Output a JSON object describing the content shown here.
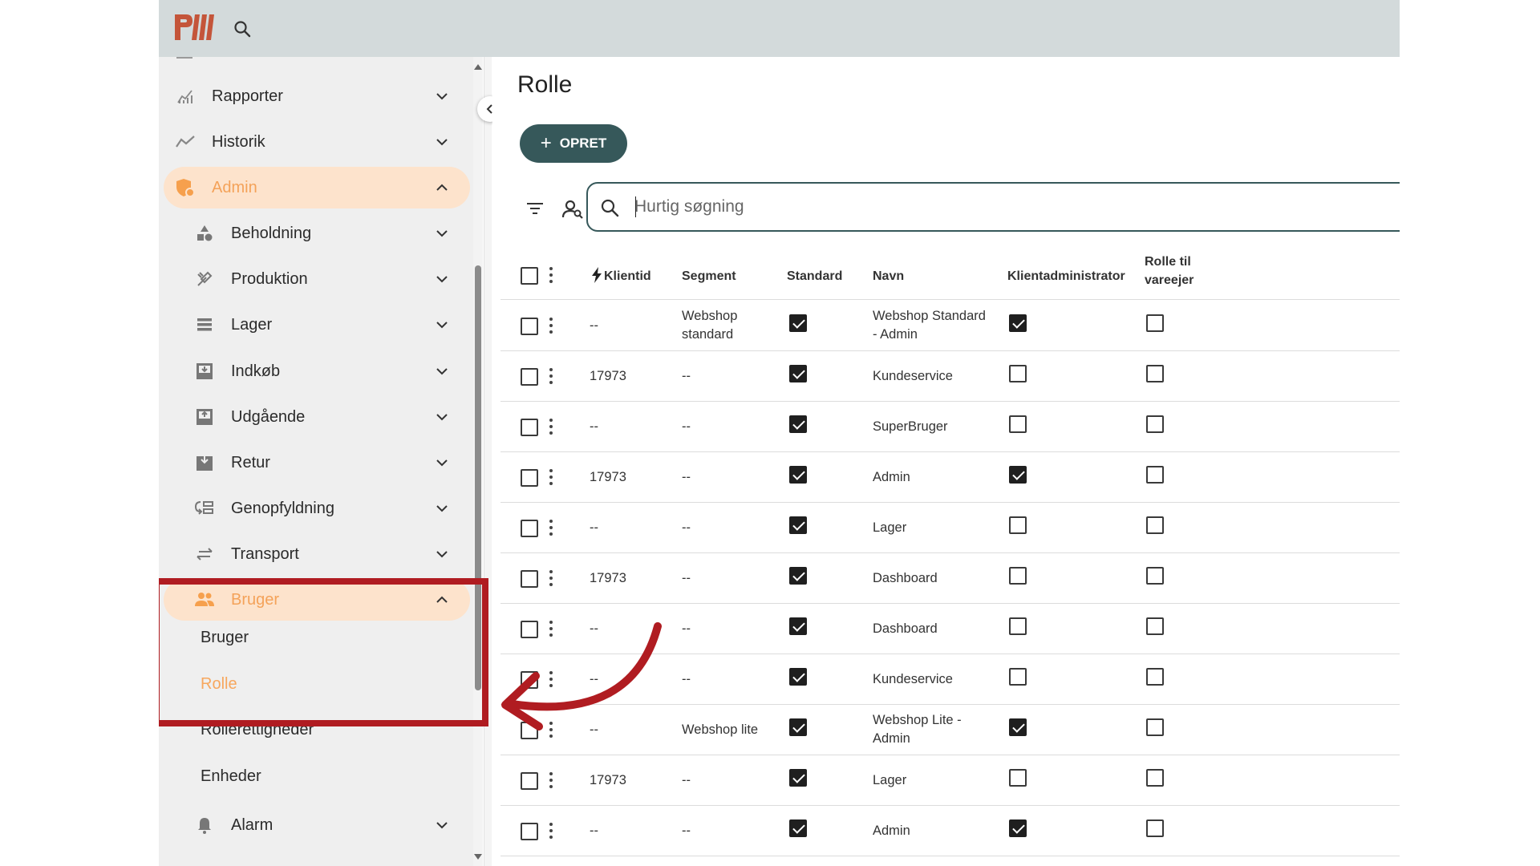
{
  "app": {
    "logo_text": "PW"
  },
  "sidebar": {
    "items": [
      {
        "label": "Rapporter",
        "icon": "reports-chart-icon"
      },
      {
        "label": "Historik",
        "icon": "trend-line-icon"
      },
      {
        "label": "Admin",
        "icon": "admin-shield-icon",
        "active": true,
        "expanded": true
      },
      {
        "label": "Beholdning",
        "icon": "shapes-icon"
      },
      {
        "label": "Produktion",
        "icon": "tools-icon"
      },
      {
        "label": "Lager",
        "icon": "list-icon"
      },
      {
        "label": "Indkøb",
        "icon": "inbox-in-icon"
      },
      {
        "label": "Udgående",
        "icon": "outbox-icon"
      },
      {
        "label": "Retur",
        "icon": "return-box-icon"
      },
      {
        "label": "Genopfyldning",
        "icon": "refill-icon"
      },
      {
        "label": "Transport",
        "icon": "transfer-arrows-icon"
      },
      {
        "label": "Bruger",
        "icon": "users-icon",
        "active": true,
        "expanded": true
      }
    ],
    "bruger_sub": [
      {
        "label": "Bruger"
      },
      {
        "label": "Rolle",
        "active": true
      },
      {
        "label": "Rollerettigheder"
      },
      {
        "label": "Enheder"
      }
    ],
    "alarm": {
      "label": "Alarm",
      "icon": "bell-icon"
    }
  },
  "main": {
    "title": "Rolle",
    "create_label": "OPRET",
    "search": {
      "placeholder": "Hurtig søgning",
      "value": ""
    }
  },
  "table": {
    "headers": {
      "klientid": "Klientid",
      "segment": "Segment",
      "standard": "Standard",
      "navn": "Navn",
      "klientadministrator": "Klientadministrator",
      "rolle_til_vareejer": "Rolle til\nvareejer"
    },
    "rows": [
      {
        "klientid": "--",
        "segment": "Webshop\nstandard",
        "standard": true,
        "navn": "Webshop Standard\n- Admin",
        "klientadmin": true,
        "vareejer": false
      },
      {
        "klientid": "17973",
        "segment": "--",
        "standard": true,
        "navn": "Kundeservice",
        "klientadmin": false,
        "vareejer": false
      },
      {
        "klientid": "--",
        "segment": "--",
        "standard": true,
        "navn": "SuperBruger",
        "klientadmin": false,
        "vareejer": false
      },
      {
        "klientid": "17973",
        "segment": "--",
        "standard": true,
        "navn": "Admin",
        "klientadmin": true,
        "vareejer": false
      },
      {
        "klientid": "--",
        "segment": "--",
        "standard": true,
        "navn": "Lager",
        "klientadmin": false,
        "vareejer": false
      },
      {
        "klientid": "17973",
        "segment": "--",
        "standard": true,
        "navn": "Dashboard",
        "klientadmin": false,
        "vareejer": false
      },
      {
        "klientid": "--",
        "segment": "--",
        "standard": true,
        "navn": "Dashboard",
        "klientadmin": false,
        "vareejer": false
      },
      {
        "klientid": "--",
        "segment": "--",
        "standard": true,
        "navn": "Kundeservice",
        "klientadmin": false,
        "vareejer": false
      },
      {
        "klientid": "--",
        "segment": "Webshop lite",
        "standard": true,
        "navn": "Webshop Lite -\nAdmin",
        "klientadmin": true,
        "vareejer": false
      },
      {
        "klientid": "17973",
        "segment": "--",
        "standard": true,
        "navn": "Lager",
        "klientadmin": false,
        "vareejer": false
      },
      {
        "klientid": "--",
        "segment": "--",
        "standard": true,
        "navn": "Admin",
        "klientadmin": true,
        "vareejer": false
      }
    ]
  },
  "colors": {
    "topbar": "#d3dadb",
    "sidebar_bg": "#efefef",
    "active_bg": "#fde3cc",
    "active_text": "#f4a259",
    "primary": "#36585a",
    "annotation_red": "#b01c21"
  }
}
